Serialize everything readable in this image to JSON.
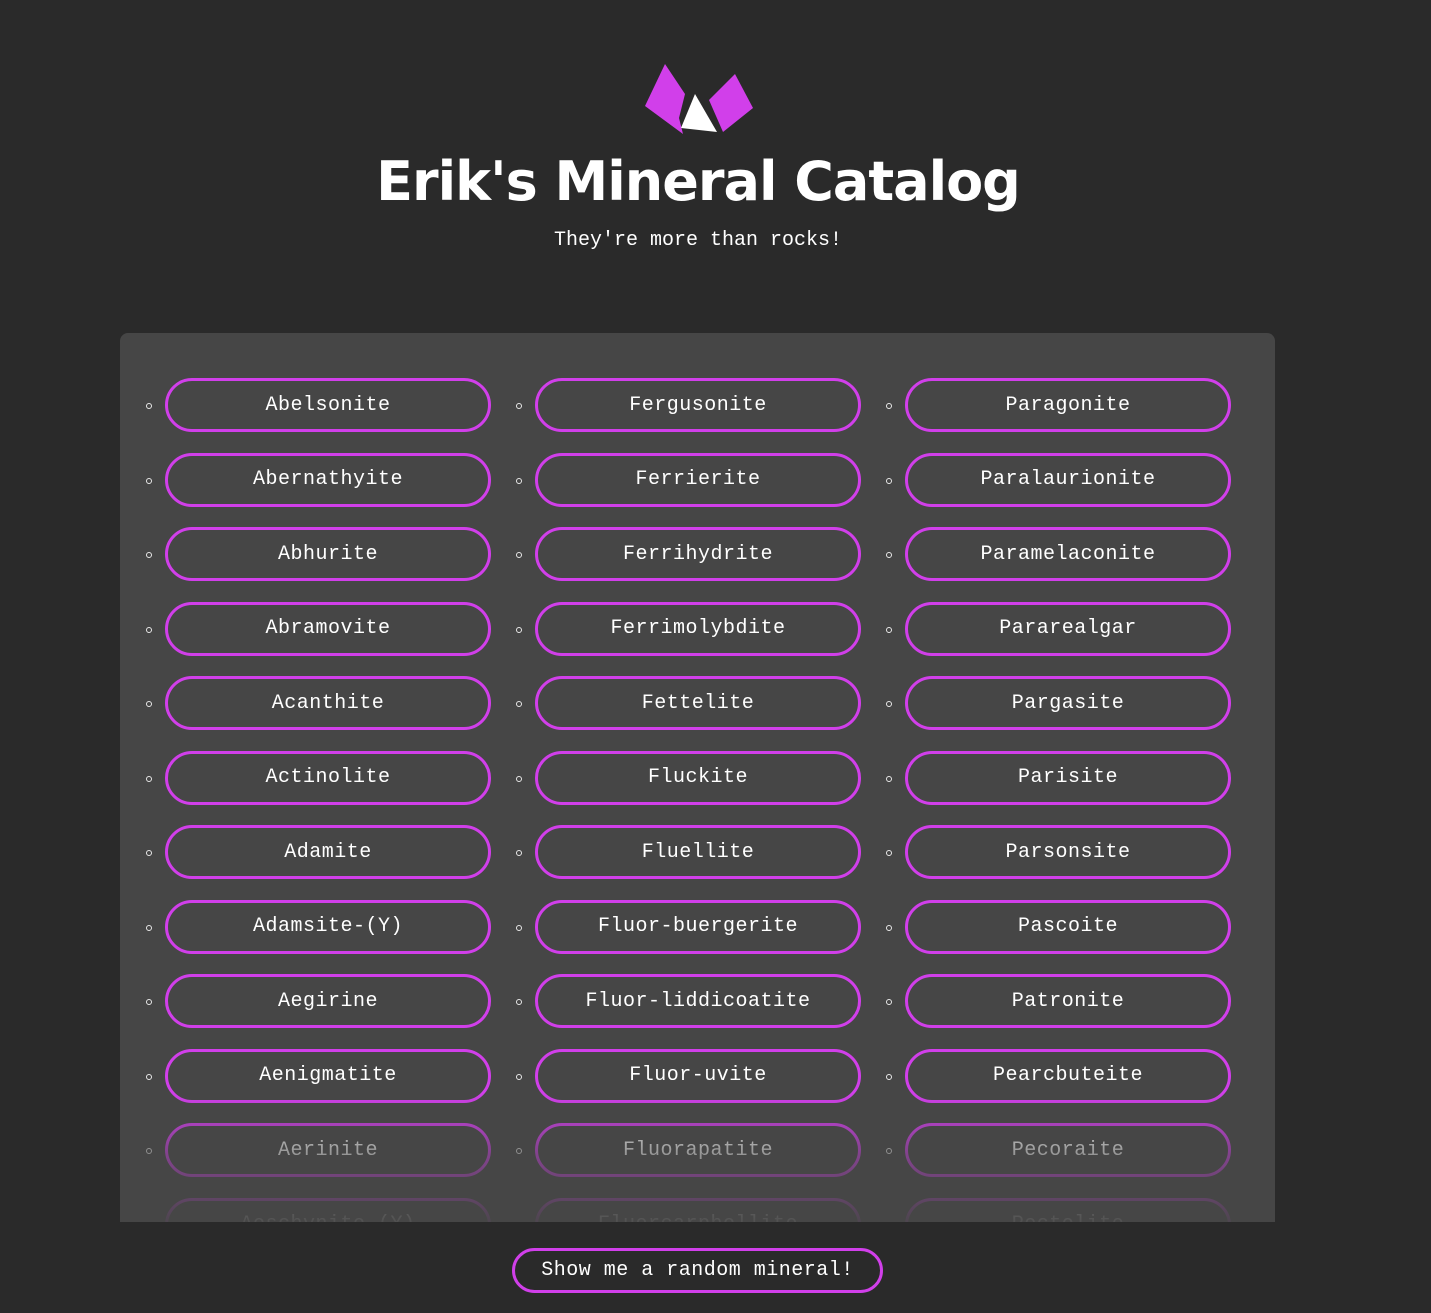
{
  "header": {
    "logo_icon": "mineral-crystal-logo-icon",
    "title": "Erik's Mineral Catalog",
    "subtitle": "They're more than rocks!"
  },
  "colors": {
    "background": "#2a2a2a",
    "panel": "#464646",
    "accent": "#d13fea",
    "text": "#ffffff"
  },
  "minerals": {
    "column_1": [
      "Abelsonite",
      "Abernathyite",
      "Abhurite",
      "Abramovite",
      "Acanthite",
      "Actinolite",
      "Adamite",
      "Adamsite-(Y)",
      "Aegirine",
      "Aenigmatite",
      "Aerinite",
      "Aeschynite-(Y)"
    ],
    "column_2": [
      "Fergusonite",
      "Ferrierite",
      "Ferrihydrite",
      "Ferrimolybdite",
      "Fettelite",
      "Fluckite",
      "Fluellite",
      "Fluor-buergerite",
      "Fluor-liddicoatite",
      "Fluor-uvite",
      "Fluorapatite",
      "Fluorcarphollite"
    ],
    "column_3": [
      "Paragonite",
      "Paralaurionite",
      "Paramelaconite",
      "Pararealgar",
      "Pargasite",
      "Parisite",
      "Parsonsite",
      "Pascoite",
      "Patronite",
      "Pearcbuteite",
      "Pecoraite",
      "Pectolite"
    ]
  },
  "footer": {
    "random_button_label": "Show me a random mineral!"
  }
}
